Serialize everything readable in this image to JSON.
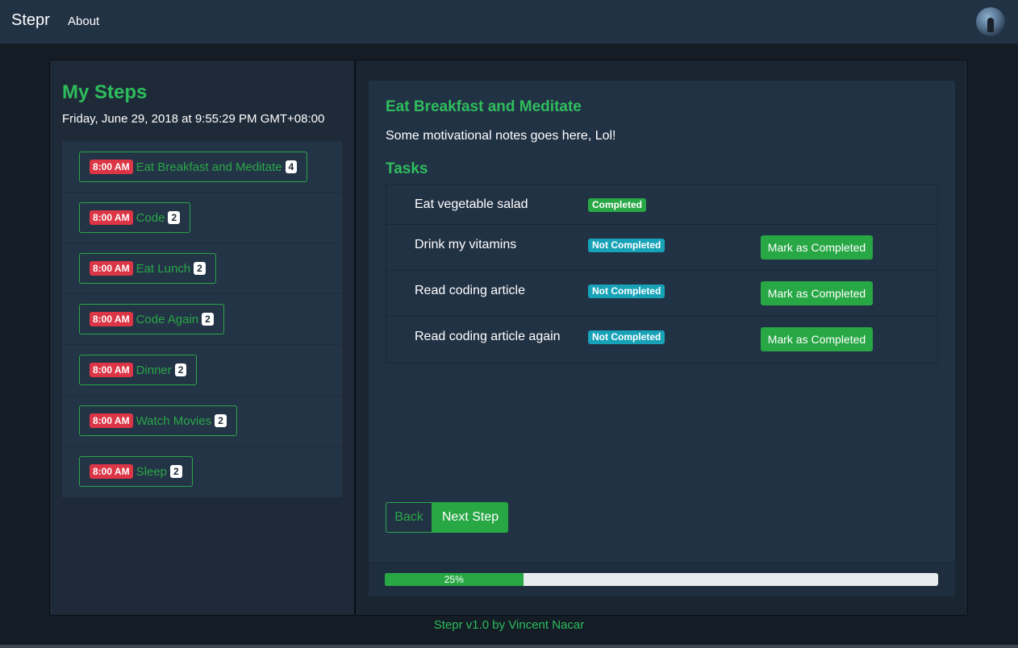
{
  "navbar": {
    "brand": "Stepr",
    "about_label": "About",
    "avatar_icon": "user-avatar-photo"
  },
  "sidebar": {
    "title": "My Steps",
    "date": "Friday, June 29, 2018 at 9:55:29 PM GMT+08:00",
    "steps": [
      {
        "time": "8:00 AM",
        "label": "Eat Breakfast and Meditate",
        "count": "4"
      },
      {
        "time": "8:00 AM",
        "label": "Code",
        "count": "2"
      },
      {
        "time": "8:00 AM",
        "label": "Eat Lunch",
        "count": "2"
      },
      {
        "time": "8:00 AM",
        "label": "Code Again",
        "count": "2"
      },
      {
        "time": "8:00 AM",
        "label": "Dinner",
        "count": "2"
      },
      {
        "time": "8:00 AM",
        "label": "Watch Movies",
        "count": "2"
      },
      {
        "time": "8:00 AM",
        "label": "Sleep",
        "count": "2"
      }
    ]
  },
  "detail": {
    "title": "Eat Breakfast and Meditate",
    "notes": "Some motivational notes goes here, Lol!",
    "tasks_heading": "Tasks",
    "tasks": [
      {
        "name": "Eat vegetable salad",
        "status": "Completed",
        "action": ""
      },
      {
        "name": "Drink my vitamins",
        "status": "Not Completed",
        "action": "Mark as Completed"
      },
      {
        "name": "Read coding article",
        "status": "Not Completed",
        "action": "Mark as Completed"
      },
      {
        "name": "Read coding article again",
        "status": "Not Completed",
        "action": "Mark as Completed"
      }
    ],
    "back_label": "Back",
    "next_label": "Next Step",
    "progress": {
      "value": 25,
      "label": "25%"
    }
  },
  "footer": {
    "text": "Stepr v1.0 by Vincent Nacar"
  },
  "colors": {
    "accent_green": "#28a745",
    "time_badge_red": "#dc3545",
    "info_teal": "#17a2b8",
    "navbar_bg": "#223245"
  }
}
